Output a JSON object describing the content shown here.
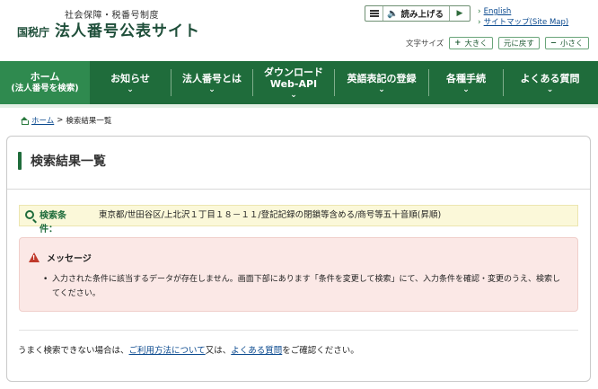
{
  "header": {
    "logo_sub": "社会保障・税番号制度",
    "logo_agency": "国税庁",
    "logo_title": "法人番号公表サイト",
    "reader_label": "読み上げる",
    "lang_english": "English",
    "lang_sitemap": "サイトマップ(Site Map)",
    "fontsize_label": "文字サイズ",
    "fontsize_large": "大きく",
    "fontsize_reset": "元に戻す",
    "fontsize_small": "小さく",
    "fontsize_large_sym": "+",
    "fontsize_small_sym": "−"
  },
  "nav": {
    "home_line1": "ホーム",
    "home_line2": "(法人番号を検索)",
    "items": [
      {
        "label": "お知らせ"
      },
      {
        "label": "法人番号とは"
      },
      {
        "label": "ダウンロード",
        "label2": "Web-API"
      },
      {
        "label": "英語表記の登録"
      },
      {
        "label": "各種手続"
      },
      {
        "label": "よくある質問"
      }
    ],
    "chevron": "⌄"
  },
  "breadcrumb": {
    "home": "ホーム",
    "separator": ">",
    "current": "検索結果一覧"
  },
  "main": {
    "title": "検索結果一覧",
    "condition_label": "検索条件：",
    "condition_value": "東京都/世田谷区/上北沢１丁目１８－１１/登記記録の閉鎖等含める/商号等五十音順(昇順)",
    "message_title": "メッセージ",
    "message_items": [
      "入力された条件に該当するデータが存在しません。画面下部にあります「条件を変更して検索」にて、入力条件を確認・変更のうえ、検索してください。"
    ],
    "help_prefix": "うまく検索できない場合は、",
    "help_link1": "ご利用方法について",
    "help_middle": "又は、",
    "help_link2": "よくある質問",
    "help_suffix": "をご確認ください。"
  },
  "colors": {
    "brand_green": "#1f6c3b",
    "nav_home_bg": "#2f8a4f",
    "condition_bg": "#fbf8d9",
    "message_bg": "#fbe8e6",
    "warning_red": "#c0392b"
  }
}
